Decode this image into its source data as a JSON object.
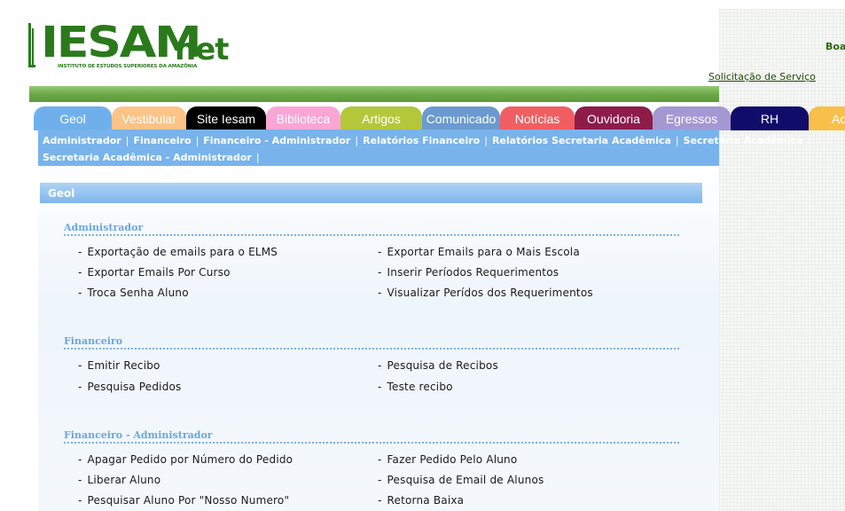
{
  "header": {
    "logo_main": "IESAM",
    "logo_net": "net",
    "logo_subtitle": "INSTITUTO DE ESTUDOS SUPERIORES DA AMAZÔNIA",
    "greeting": "Boa",
    "service_link": "Solicitação de Serviço"
  },
  "tabs": [
    {
      "label": "Geol",
      "bg": "#6fb0ec",
      "fg": "#ffffff"
    },
    {
      "label": "Vestibular",
      "bg": "#fcc386",
      "fg": "#ffffff"
    },
    {
      "label": "Site Iesam",
      "bg": "#000000",
      "fg": "#ffffff"
    },
    {
      "label": "Biblioteca",
      "bg": "#f9a6d6",
      "fg": "#ffffff"
    },
    {
      "label": "Artigos",
      "bg": "#b4c73a",
      "fg": "#ffffff"
    },
    {
      "label": "Comunicado",
      "bg": "#6a9ad0",
      "fg": "#ffffff"
    },
    {
      "label": "Notícias",
      "bg": "#f15e62",
      "fg": "#ffffff"
    },
    {
      "label": "Ouvidoria",
      "bg": "#8d1c4a",
      "fg": "#ffffff"
    },
    {
      "label": "Egressos",
      "bg": "#a498d2",
      "fg": "#ffffff"
    },
    {
      "label": "RH",
      "bg": "#100d6a",
      "fg": "#ffffff"
    },
    {
      "label": "Ac",
      "bg": "#f8c04a",
      "fg": "#ffffff"
    }
  ],
  "subnav": {
    "row1": [
      "Administrador",
      "Financeiro",
      "Financeiro - Administrador",
      "Relatórios Financeiro",
      "Relatórios Secretaria Acadêmica",
      "Secretária Acadêmica"
    ],
    "row2": [
      "Secretaria Acadêmica - Administrador"
    ]
  },
  "main": {
    "section_title": "Geol",
    "groups": [
      {
        "title": "Administrador",
        "left": [
          "Exportação de emails para o ELMS",
          "Exportar Emails Por Curso",
          "Troca Senha Aluno"
        ],
        "right": [
          "Exportar Emails para o Mais Escola",
          "Inserir Períodos Requerimentos",
          "Visualizar Perídos dos Requerimentos"
        ]
      },
      {
        "title": "Financeiro",
        "left": [
          "Emitir Recibo",
          "Pesquisa Pedidos"
        ],
        "right": [
          "Pesquisa de Recibos",
          "Teste recibo"
        ]
      },
      {
        "title": "Financeiro - Administrador",
        "left": [
          "Apagar Pedido por Número do Pedido",
          "Liberar Aluno",
          "Pesquisar Aluno Por \"Nosso Numero\""
        ],
        "right": [
          "Fazer Pedido Pelo Aluno",
          "Pesquisa de Email de Alunos",
          "Retorna Baixa"
        ]
      }
    ]
  },
  "colors": {
    "green": "#2a7a1c",
    "subnav_blue": "#79b3ec",
    "group_title_blue": "#6aa7e0"
  }
}
